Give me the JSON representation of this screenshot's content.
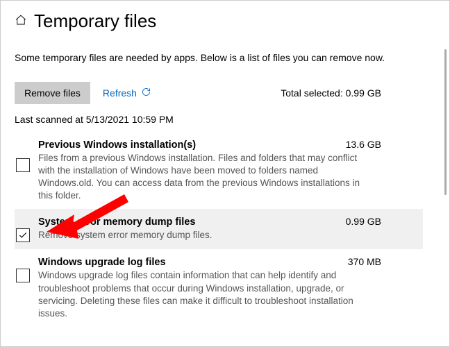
{
  "header": {
    "title": "Temporary files"
  },
  "intro": "Some temporary files are needed by apps. Below is a list of files you can remove now.",
  "actions": {
    "remove_label": "Remove files",
    "refresh_label": "Refresh",
    "total_label": "Total selected: 0.99 GB"
  },
  "scanned": "Last scanned at 5/13/2021 10:59 PM",
  "items": [
    {
      "title": "Previous Windows installation(s)",
      "size": "13.6 GB",
      "desc": "Files from a previous Windows installation.  Files and folders that may conflict with the installation of Windows have been moved to folders named Windows.old.  You can access data from the previous Windows installations in this folder.",
      "checked": false
    },
    {
      "title": "System error memory dump files",
      "size": "0.99 GB",
      "desc": "Remove system error memory dump files.",
      "checked": true
    },
    {
      "title": "Windows upgrade log files",
      "size": "370 MB",
      "desc": "Windows upgrade log files contain information that can help identify and troubleshoot problems that occur during Windows installation, upgrade, or servicing.  Deleting these files can make it difficult to troubleshoot installation issues.",
      "checked": false
    }
  ]
}
